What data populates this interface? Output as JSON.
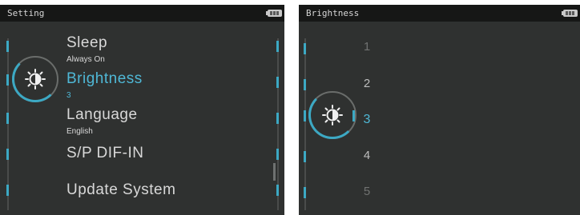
{
  "left_screen": {
    "title": "Setting",
    "menu": [
      {
        "label": "Sleep",
        "value": "Always On",
        "selected": false
      },
      {
        "label": "Brightness",
        "value": "3",
        "selected": true
      },
      {
        "label": "Language",
        "value": "English",
        "selected": false
      },
      {
        "label": "S/P DIF-IN",
        "value": "",
        "selected": false
      },
      {
        "label": "Update System",
        "value": "",
        "selected": false
      }
    ],
    "selected_icon": "brightness-sun-icon"
  },
  "right_screen": {
    "title": "Brightness",
    "options": [
      "1",
      "2",
      "3",
      "4",
      "5"
    ],
    "selected": "3",
    "selected_icon": "brightness-sun-icon"
  },
  "colors": {
    "accent": "#3ca9c4",
    "selected_text": "#4fb8d6",
    "background": "#2f3130",
    "titlebar": "#161716"
  },
  "icons": [
    "battery-icon",
    "brightness-sun-icon"
  ]
}
